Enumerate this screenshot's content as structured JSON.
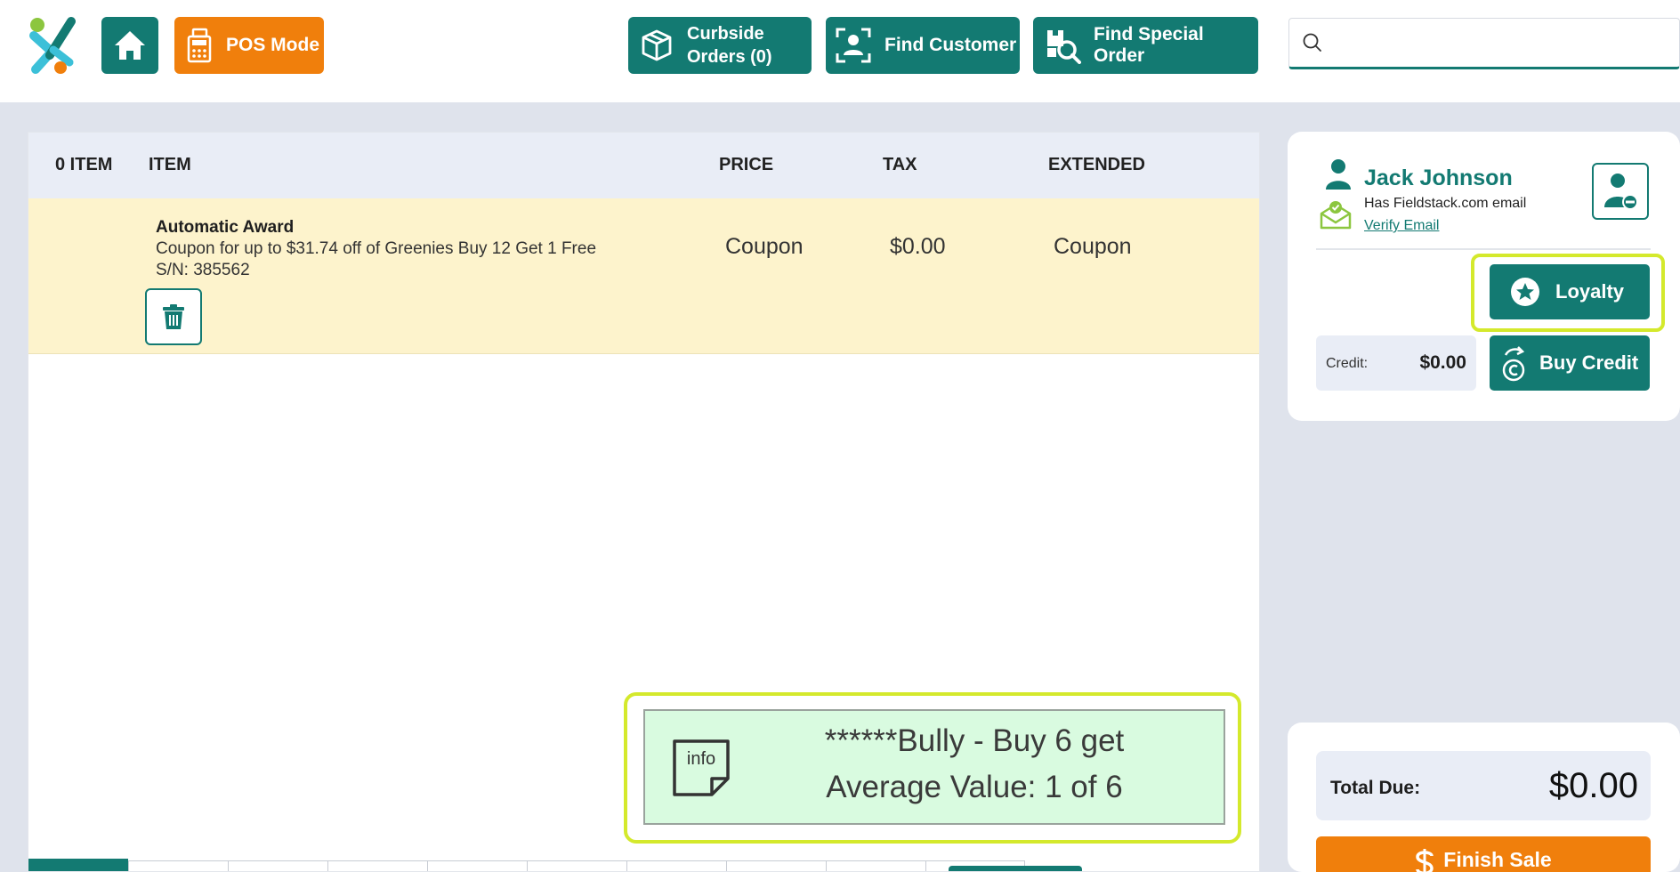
{
  "header": {
    "pos_mode_label": "POS Mode",
    "curbside_line1": "Curbside",
    "curbside_line2": "Orders (0)",
    "find_customer_label": "Find Customer",
    "find_special_order_label": "Find Special Order",
    "search_value": ""
  },
  "cart": {
    "columns": {
      "count": "0 ITEM",
      "item": "ITEM",
      "price": "PRICE",
      "tax": "TAX",
      "extended": "EXTENDED"
    },
    "items": [
      {
        "name": "Automatic Award",
        "description": "Coupon for up to $31.74 off of Greenies Buy 12 Get 1 Free",
        "serial": "S/N: 385562",
        "price": "Coupon",
        "tax": "$0.00",
        "extended": "Coupon"
      }
    ]
  },
  "promo": {
    "icon_text": "info",
    "line1": "******Bully -  Buy 6 get",
    "line2": "Average Value: 1 of 6"
  },
  "customer": {
    "name": "Jack Johnson",
    "email_status": "Has Fieldstack.com email",
    "verify_label": "Verify Email",
    "loyalty_label": "Loyalty",
    "credit_label": "Credit:",
    "credit_value": "$0.00",
    "buy_credit_label": "Buy Credit"
  },
  "totals": {
    "total_label": "Total Due:",
    "total_value": "$0.00",
    "finish_label": "Finish Sale"
  },
  "colors": {
    "brand_teal": "#137a72",
    "accent_orange": "#f07f0c",
    "highlight": "#d4e92c",
    "row_highlight": "#fdf3cc",
    "promo_bg": "#d9fbe0"
  }
}
